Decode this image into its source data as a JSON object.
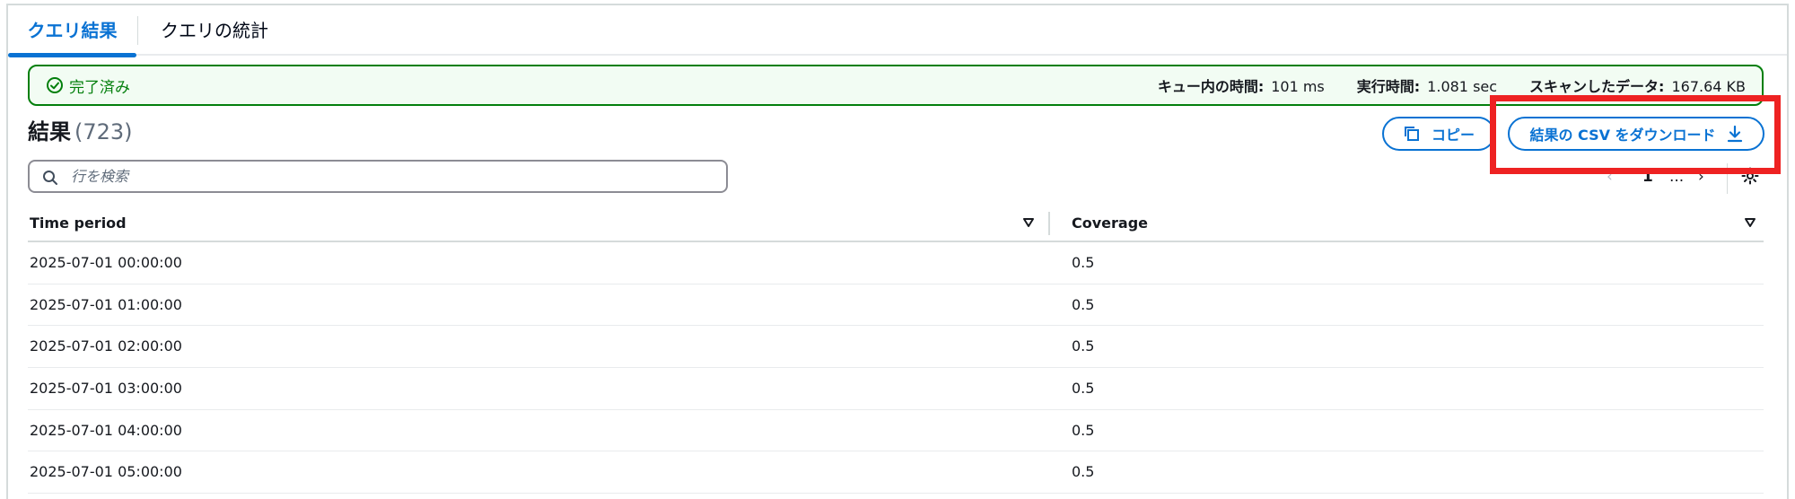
{
  "tabs": [
    {
      "label": "クエリ結果",
      "active": true
    },
    {
      "label": "クエリの統計",
      "active": false
    }
  ],
  "status": {
    "text": "完了済み",
    "queue_time_label": "キュー内の時間:",
    "queue_time_value": "101 ms",
    "exec_time_label": "実行時間:",
    "exec_time_value": "1.081 sec",
    "scanned_label": "スキャンしたデータ:",
    "scanned_value": "167.64 KB"
  },
  "results": {
    "title": "結果",
    "count": "(723)"
  },
  "buttons": {
    "copy": "コピー",
    "download": "結果の CSV をダウンロード"
  },
  "search": {
    "placeholder": "行を検索"
  },
  "pagination": {
    "prev": "‹",
    "current_page": "1",
    "ellipsis": "...",
    "next": "›"
  },
  "table": {
    "columns": [
      "Time period",
      "Coverage"
    ],
    "rows": [
      [
        "2025-07-01 00:00:00",
        "0.5"
      ],
      [
        "2025-07-01 01:00:00",
        "0.5"
      ],
      [
        "2025-07-01 02:00:00",
        "0.5"
      ],
      [
        "2025-07-01 03:00:00",
        "0.5"
      ],
      [
        "2025-07-01 04:00:00",
        "0.5"
      ],
      [
        "2025-07-01 05:00:00",
        "0.5"
      ]
    ]
  },
  "colors": {
    "accent": "#0972d3",
    "success": "#037f0c",
    "success_bg": "#f2fcf3",
    "highlight": "#ee2222"
  }
}
